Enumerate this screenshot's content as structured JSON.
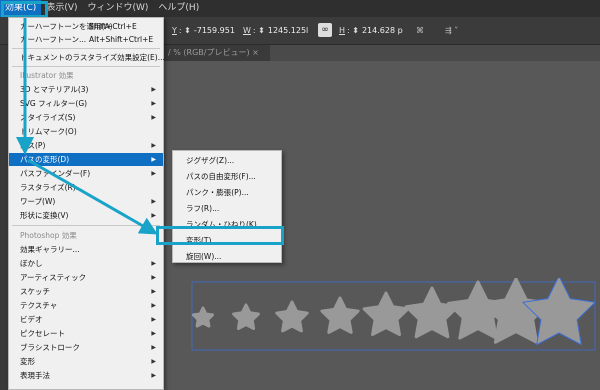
{
  "menubar": {
    "items": [
      "効果(C)",
      "表示(V)",
      "ウィンドウ(W)",
      "ヘルプ(H)"
    ]
  },
  "controlbar": {
    "y_label": "Y",
    "y_value": "-7159.951",
    "w_label": "W",
    "w_value": "1245.125l",
    "h_label": "H",
    "h_value": "214.628 p",
    "link_icon": "∞"
  },
  "doc_tab": "/ % (RGB/プレビュー)  ×",
  "effect_menu": {
    "apply_last": "カーハーフトーンを適用(A)",
    "apply_last_shortcut": "Shift+Ctrl+E",
    "last_effect": "カーハーフトーン...",
    "last_effect_shortcut": "Alt+Shift+Ctrl+E",
    "raster_settings": "ドキュメントのラスタライズ効果設定(E)...",
    "illustrator_header": "Illustrator 効果",
    "illustrator_items": [
      "3D とマテリアル(3)",
      "SVG フィルター(G)",
      "スタイライズ(S)",
      "トリムマーク(O)",
      "パス(P)",
      "パスの変形(D)",
      "パスファインダー(F)",
      "ラスタライズ(R)...",
      "ワープ(W)",
      "形状に変換(V)"
    ],
    "photoshop_header": "Photoshop 効果",
    "photoshop_items": [
      "効果ギャラリー...",
      "ぼかし",
      "アーティスティック",
      "スケッチ",
      "テクスチャ",
      "ビデオ",
      "ピクセレート",
      "ブラシストローク",
      "変形",
      "表現手法"
    ]
  },
  "submenu": {
    "items": [
      "ジグザグ(Z)...",
      "パスの自由変形(F)...",
      "パンク・膨張(P)...",
      "ラフ(R)...",
      "ランダム・ひねり(K)...",
      "変形(T)...",
      "旋回(W)..."
    ]
  },
  "colors": {
    "highlight": "#0f6fc2",
    "callout": "#1aa3c8",
    "star_fill": "#999999"
  }
}
